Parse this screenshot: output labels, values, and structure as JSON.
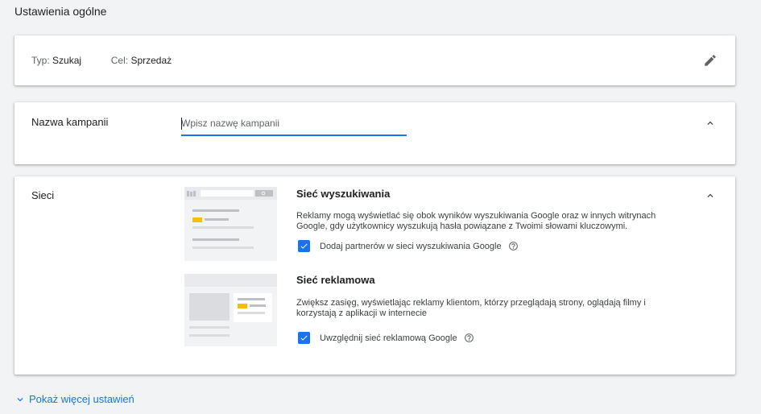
{
  "page": {
    "title": "Ustawienia ogólne"
  },
  "type_card": {
    "type_label": "Typ:",
    "type_value": "Szukaj",
    "goal_label": "Cel:",
    "goal_value": "Sprzedaż",
    "edit_icon": "pencil-icon"
  },
  "name_card": {
    "label": "Nazwa kampanii",
    "input_value": "",
    "input_placeholder": "Wpisz nazwę kampanii",
    "collapse_icon": "chevron-up-icon"
  },
  "networks_card": {
    "label": "Sieci",
    "collapse_icon": "chevron-up-icon",
    "search_network": {
      "title": "Sieć wyszukiwania",
      "description": "Reklamy mogą wyświetlać się obok wyników wyszukiwania Google oraz w innych witrynach Google, gdy użytkownicy wyszukują hasła powiązane z Twoimi słowami kluczowymi.",
      "checkbox_label": "Dodaj partnerów w sieci wyszukiwania Google",
      "checked": true
    },
    "display_network": {
      "title": "Sieć reklamowa",
      "description": "Zwiększ zasięg, wyświetlając reklamy klientom, którzy przeglądają strony, oglądają filmy i korzystają z aplikacji w internecie",
      "checkbox_label": "Uwzględnij sieć reklamową Google",
      "checked": true
    }
  },
  "footer": {
    "more_settings": "Pokaż więcej ustawień"
  },
  "colors": {
    "accent": "#1a73e8",
    "ad_yellow": "#fbbc04",
    "background": "#f1f3f4"
  }
}
